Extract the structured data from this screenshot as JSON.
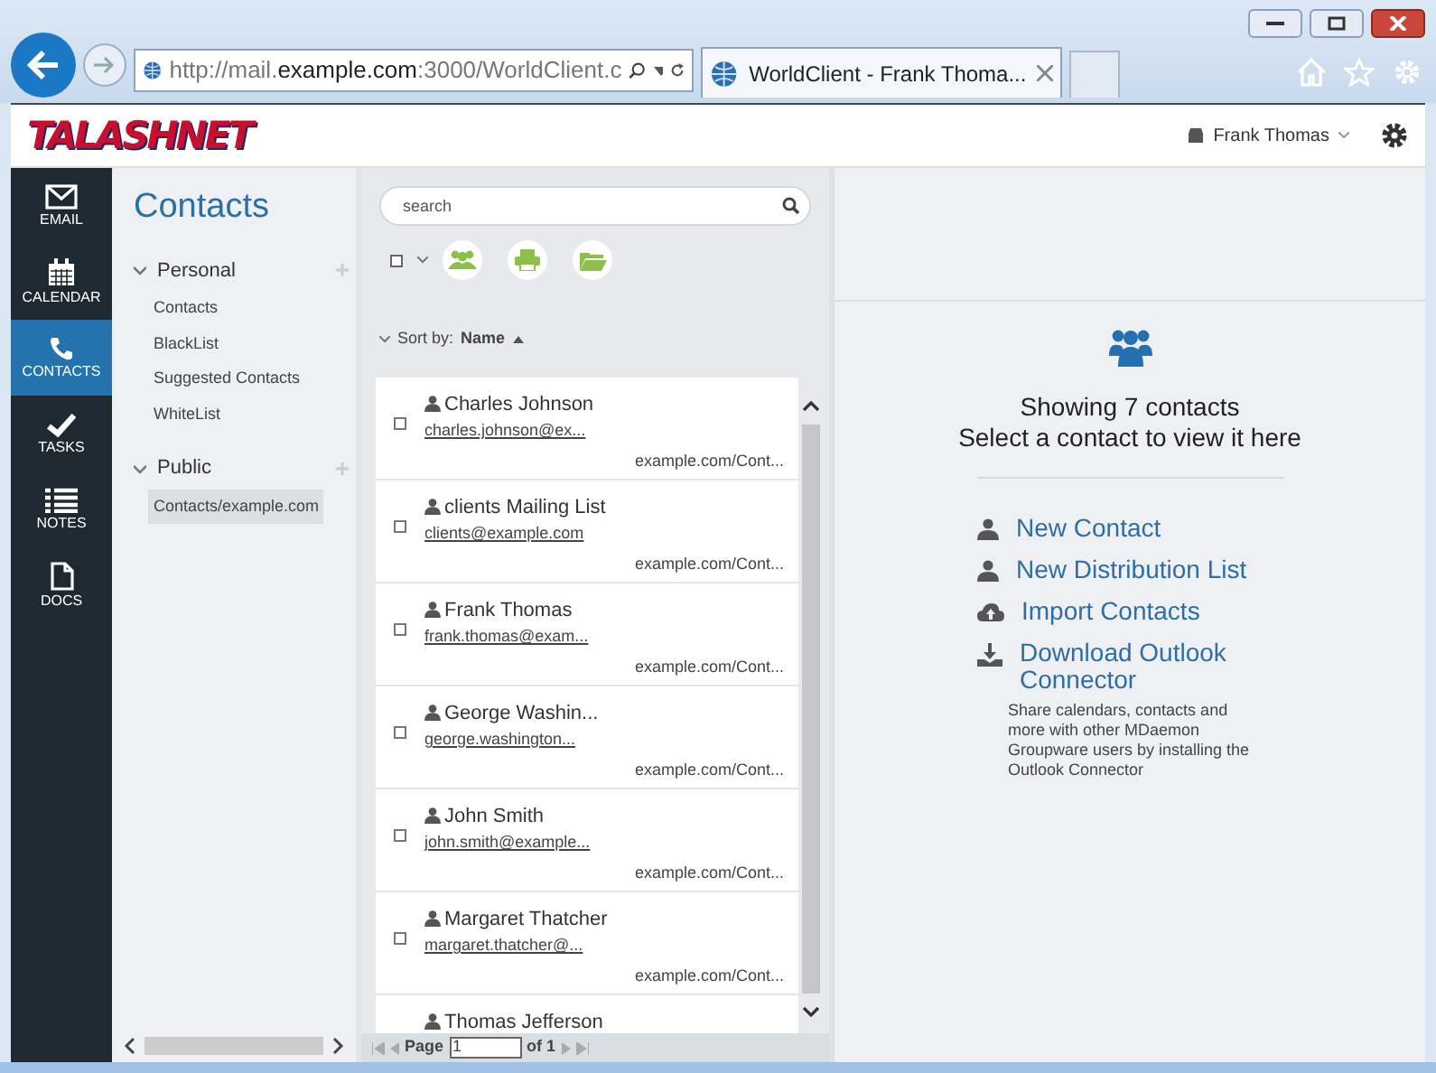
{
  "browser": {
    "url": "http://mail.**example.com**:3000/WorldClient.c",
    "tab_title": "WorldClient - Frank Thoma..."
  },
  "header": {
    "logo": "TALASHNET",
    "user": "Frank Thomas"
  },
  "nav": [
    {
      "label": "EMAIL",
      "selected": false
    },
    {
      "label": "CALENDAR",
      "selected": false
    },
    {
      "label": "CONTACTS",
      "selected": true
    },
    {
      "label": "TASKS",
      "selected": false
    },
    {
      "label": "NOTES",
      "selected": false
    },
    {
      "label": "DOCS",
      "selected": false
    }
  ],
  "folders": {
    "title": "Contacts",
    "groups": [
      {
        "label": "Personal",
        "expanded": true,
        "children": [
          {
            "label": "Contacts",
            "selected": false
          },
          {
            "label": "BlackList",
            "selected": false
          },
          {
            "label": "Suggested Contacts",
            "selected": false
          },
          {
            "label": "WhiteList",
            "selected": false
          }
        ]
      },
      {
        "label": "Public",
        "expanded": true,
        "children": [
          {
            "label": "Contacts/example.com",
            "selected": true
          }
        ]
      }
    ]
  },
  "list": {
    "search": {
      "placeholder": "search"
    },
    "select_all_checked": false,
    "sort_label": "Sort by:",
    "sort_field": "Name",
    "contacts": [
      {
        "name": "Charles Johnson",
        "email": "charles.johnson@ex...",
        "folder": "example.com/Cont...",
        "checked": false
      },
      {
        "name": "clients Mailing List",
        "email": "clients@example.com",
        "folder": "example.com/Cont...",
        "checked": false
      },
      {
        "name": "Frank Thomas",
        "email": "frank.thomas@exam...",
        "folder": "example.com/Cont...",
        "checked": false
      },
      {
        "name": "George Washin...",
        "email": "george.washington...",
        "folder": "example.com/Cont...",
        "checked": false
      },
      {
        "name": "John Smith",
        "email": "john.smith@example...",
        "folder": "example.com/Cont...",
        "checked": false
      },
      {
        "name": "Margaret Thatcher",
        "email": "margaret.thatcher@...",
        "folder": "example.com/Cont...",
        "checked": false
      },
      {
        "name": "Thomas Jefferson"
      }
    ],
    "pager": {
      "label": "Page",
      "value": "1",
      "of": "of 1"
    }
  },
  "detail": {
    "count": "Showing 7 contacts",
    "hint": "Select a contact to view it here",
    "actions": [
      {
        "label": "New Contact"
      },
      {
        "label": "New Distribution List"
      },
      {
        "label": "Import Contacts"
      },
      {
        "label": "Download Outlook Connector"
      }
    ],
    "note": "Share calendars, contacts and more with other MDaemon Groupware users by installing the Outlook Connector"
  }
}
